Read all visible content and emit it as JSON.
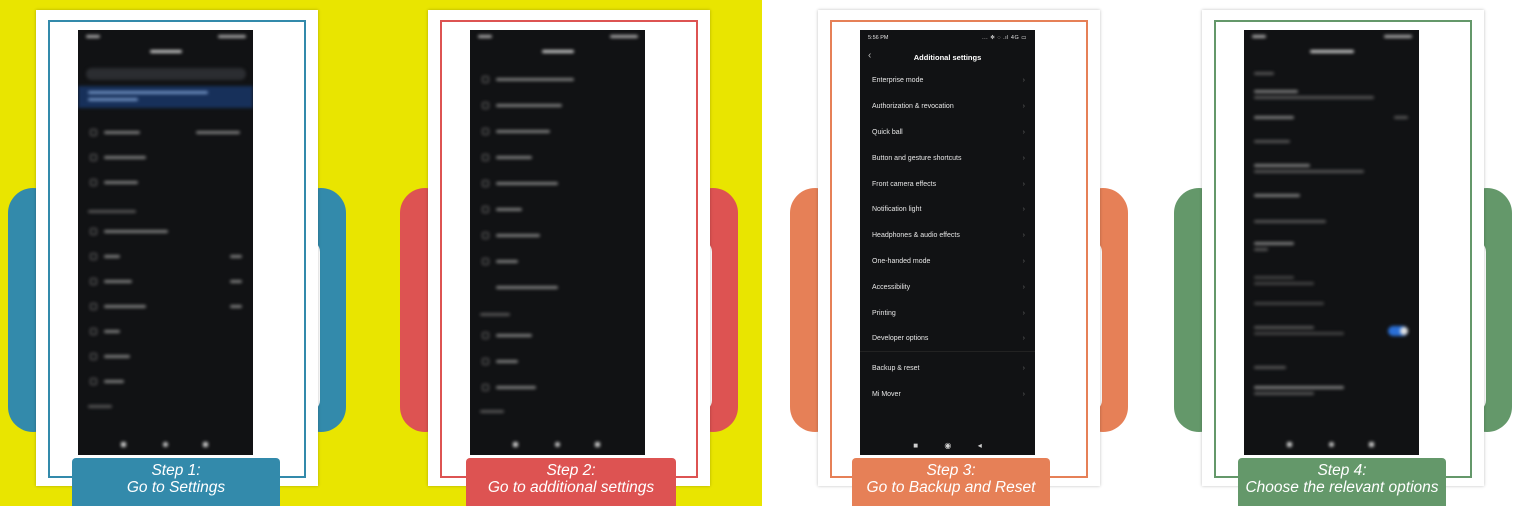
{
  "colors": {
    "background_left": "#e9e500",
    "step1": "#338aab",
    "step2": "#dd5352",
    "step3": "#e68057",
    "step4": "#64986a"
  },
  "steps": [
    {
      "title": "Step 1:",
      "subtitle": "Go to Settings"
    },
    {
      "title": "Step 2:",
      "subtitle": "Go to additional settings"
    },
    {
      "title": "Step 3:",
      "subtitle": "Go to Backup and Reset"
    },
    {
      "title": "Step 4:",
      "subtitle": "Choose the relevant options"
    }
  ],
  "phone3": {
    "time": "5:56 PM",
    "status_icons": "... ✻ ◌ .ıl 4G ▭",
    "title": "Additional settings",
    "items": [
      "Enterprise mode",
      "Authorization & revocation",
      "Quick ball",
      "Button and gesture shortcuts",
      "Front camera effects",
      "Notification light",
      "Headphones & audio effects",
      "One-handed mode",
      "Accessibility",
      "Printing",
      "Developer options",
      "Backup & reset",
      "Mi Mover"
    ],
    "nav": {
      "recents": "■",
      "home": "◉",
      "back": "◂"
    }
  },
  "icons": {
    "back": "back-arrow-icon",
    "chevron": "chevron-right-icon"
  }
}
